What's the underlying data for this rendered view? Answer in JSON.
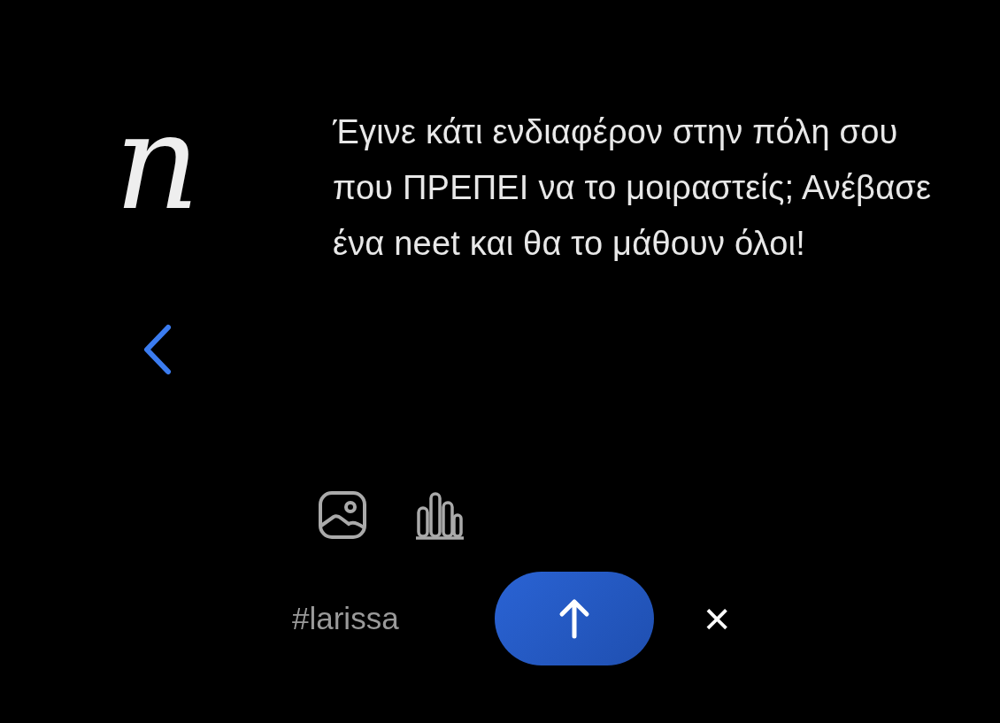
{
  "logo": {
    "text": "n"
  },
  "post_text": "Έγινε κάτι ενδιαφέρον στην πόλη σου που ΠΡΕΠΕΙ να το μοιραστείς; Ανέβασε ένα neet και θα το μάθουν όλοι!",
  "attachments": [
    {
      "kind": "image"
    },
    {
      "kind": "poll"
    }
  ],
  "hashtag": "#larissa",
  "close": "×"
}
